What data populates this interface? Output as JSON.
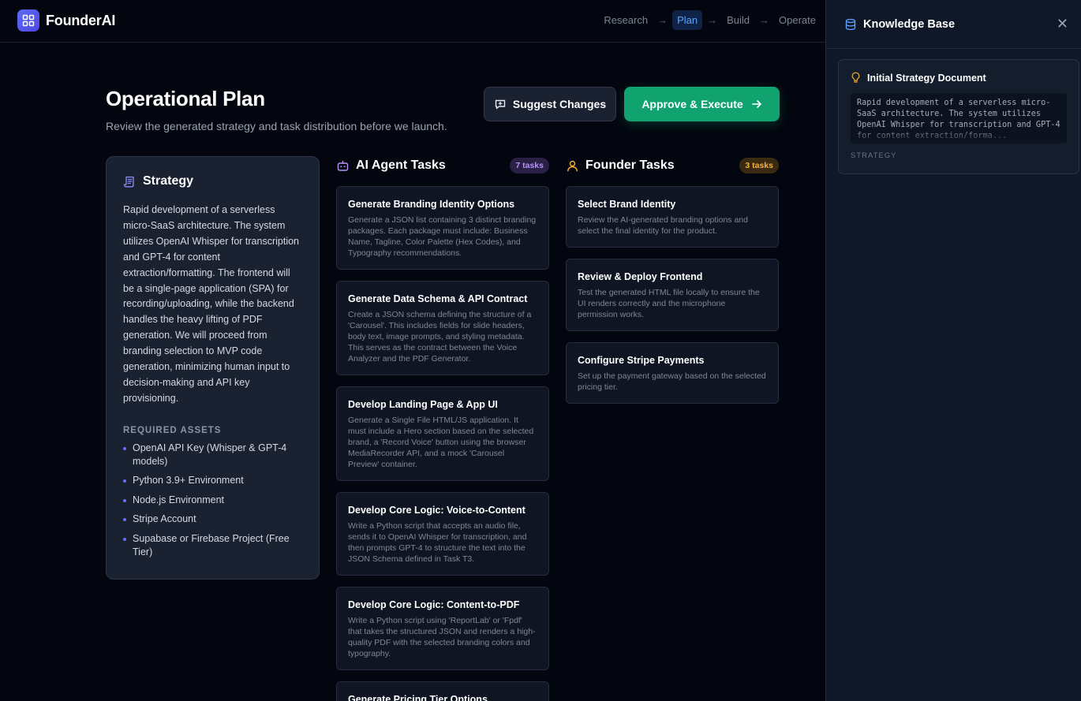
{
  "app": {
    "name": "FounderAI"
  },
  "steps": [
    {
      "label": "Research",
      "active": false
    },
    {
      "label": "Plan",
      "active": true
    },
    {
      "label": "Build",
      "active": false
    },
    {
      "label": "Operate",
      "active": false
    }
  ],
  "header": {
    "title": "Operational Plan",
    "subtitle": "Review the generated strategy and task distribution before we launch.",
    "suggest_label": "Suggest Changes",
    "approve_label": "Approve & Execute"
  },
  "strategy": {
    "title": "Strategy",
    "text": "Rapid development of a serverless micro-SaaS architecture. The system utilizes OpenAI Whisper for transcription and GPT-4 for content extraction/formatting. The frontend will be a single-page application (SPA) for recording/uploading, while the backend handles the heavy lifting of PDF generation. We will proceed from branding selection to MVP code generation, minimizing human input to decision-making and API key provisioning.",
    "assets_label": "REQUIRED ASSETS",
    "assets": [
      "OpenAI API Key (Whisper & GPT-4 models)",
      "Python 3.9+ Environment",
      "Node.js Environment",
      "Stripe Account",
      "Supabase or Firebase Project (Free Tier)"
    ]
  },
  "agent_tasks": {
    "title": "AI Agent Tasks",
    "badge": "7 tasks",
    "items": [
      {
        "title": "Generate Branding Identity Options",
        "desc": "Generate a JSON list containing 3 distinct branding packages. Each package must include: Business Name, Tagline, Color Palette (Hex Codes), and Typography recommendations."
      },
      {
        "title": "Generate Data Schema & API Contract",
        "desc": "Create a JSON schema defining the structure of a 'Carousel'. This includes fields for slide headers, body text, image prompts, and styling metadata. This serves as the contract between the Voice Analyzer and the PDF Generator."
      },
      {
        "title": "Develop Landing Page & App UI",
        "desc": "Generate a Single File HTML/JS application. It must include a Hero section based on the selected brand, a 'Record Voice' button using the browser MediaRecorder API, and a mock 'Carousel Preview' container."
      },
      {
        "title": "Develop Core Logic: Voice-to-Content",
        "desc": "Write a Python script that accepts an audio file, sends it to OpenAI Whisper for transcription, and then prompts GPT-4 to structure the text into the JSON Schema defined in Task T3."
      },
      {
        "title": "Develop Core Logic: Content-to-PDF",
        "desc": "Write a Python script using 'ReportLab' or 'Fpdf' that takes the structured JSON and renders a high-quality PDF with the selected branding colors and typography."
      },
      {
        "title": "Generate Pricing Tier Options",
        "desc": ""
      }
    ]
  },
  "founder_tasks": {
    "title": "Founder Tasks",
    "badge": "3 tasks",
    "items": [
      {
        "title": "Select Brand Identity",
        "desc": "Review the AI-generated branding options and select the final identity for the product."
      },
      {
        "title": "Review & Deploy Frontend",
        "desc": "Test the generated HTML file locally to ensure the UI renders correctly and the microphone permission works."
      },
      {
        "title": "Configure Stripe Payments",
        "desc": "Set up the payment gateway based on the selected pricing tier."
      }
    ]
  },
  "knowledge_base": {
    "title": "Knowledge Base",
    "doc_title": "Initial Strategy Document",
    "excerpt": "Rapid development of a serverless micro-SaaS architecture. The system utilizes OpenAI Whisper for transcription and GPT-4 for content extraction/forma...",
    "tag": "STRATEGY"
  },
  "colors": {
    "accent": "#5b6cf5",
    "approve": "#10a36f",
    "agent_icon": "#b794f6",
    "founder_icon": "#f6b03b",
    "kb_icon": "#5ea2ff"
  }
}
